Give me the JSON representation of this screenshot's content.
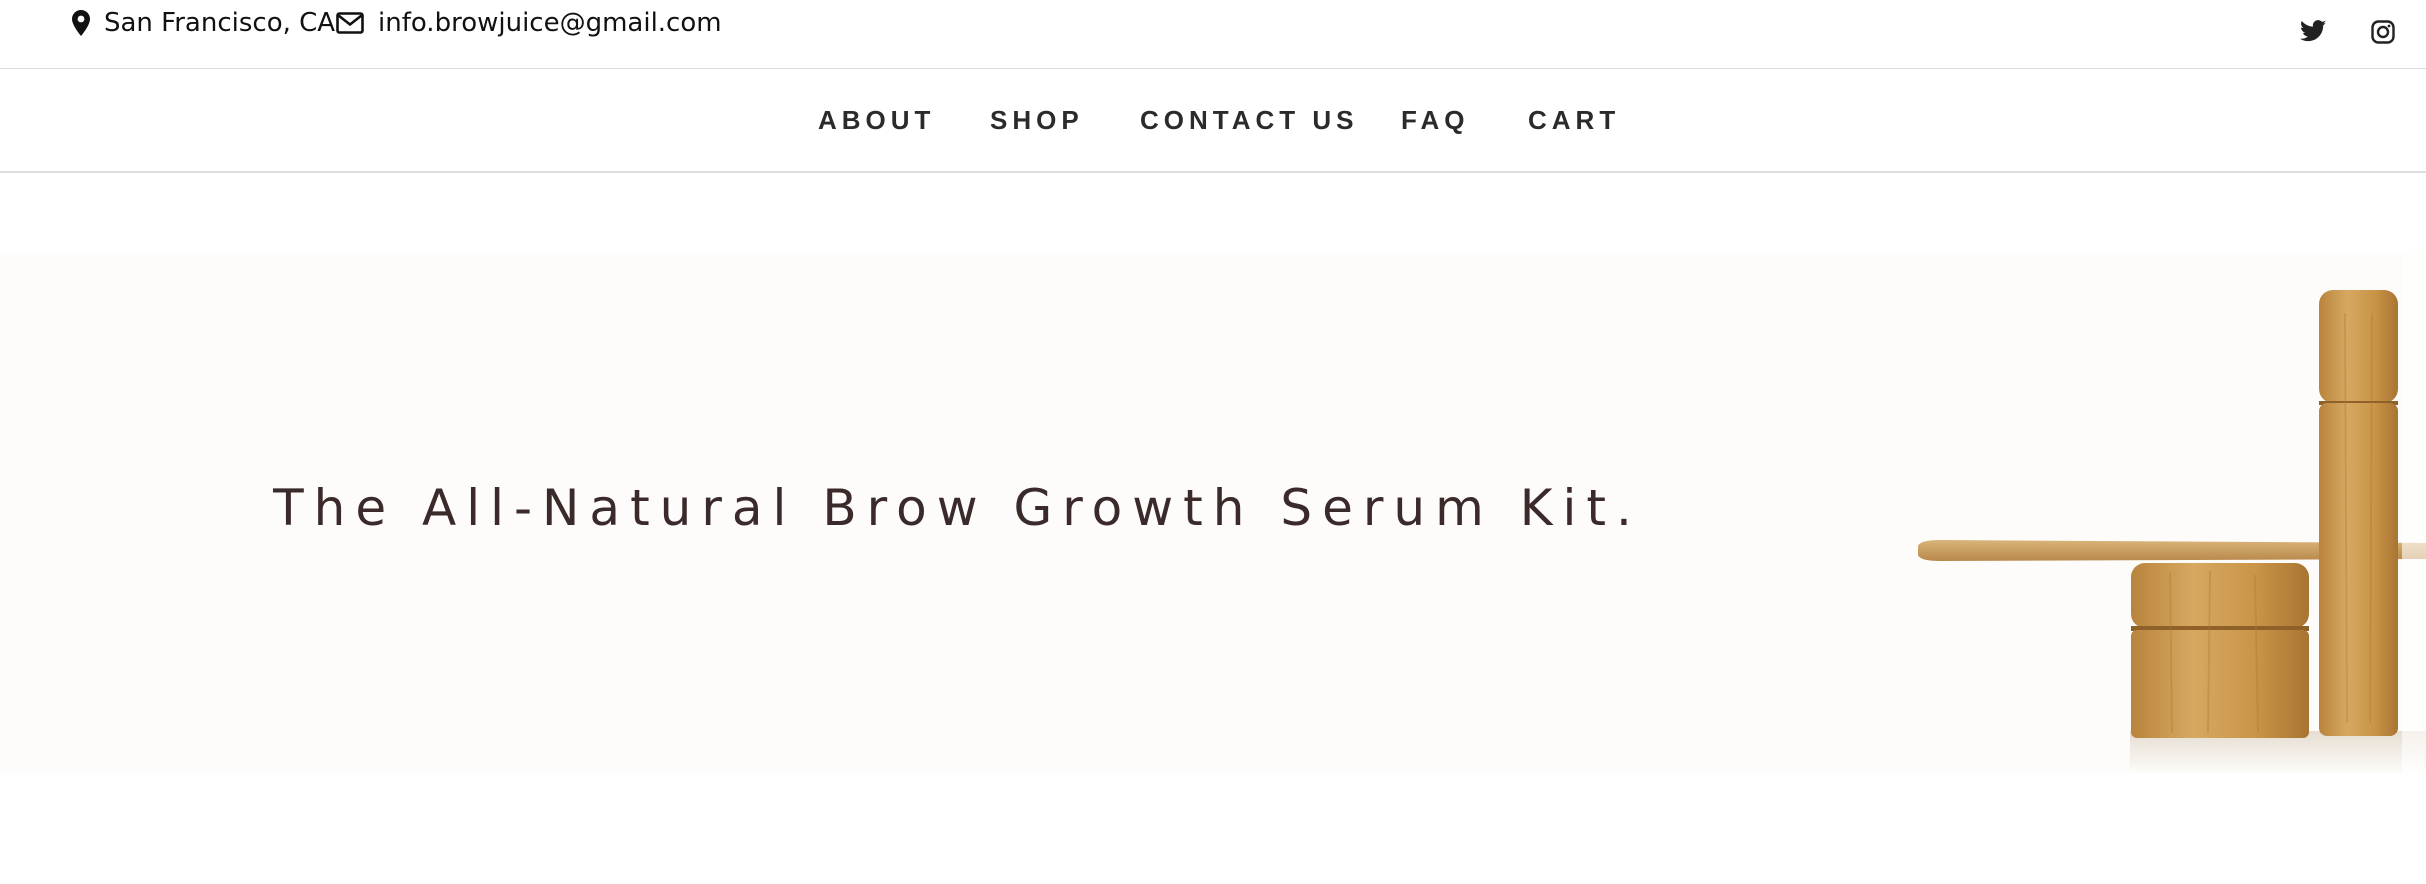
{
  "topbar": {
    "location": {
      "icon": "map-pin-icon",
      "text": "San Francisco, CA"
    },
    "email": {
      "icon": "envelope-icon",
      "text": "info.browjuice@gmail.com"
    },
    "social": [
      {
        "name": "twitter",
        "icon": "twitter-icon"
      },
      {
        "name": "instagram",
        "icon": "instagram-icon"
      }
    ]
  },
  "nav": {
    "items": [
      {
        "label": "ABOUT"
      },
      {
        "label": "SHOP"
      },
      {
        "label": "CONTACT US"
      },
      {
        "label": "FAQ"
      },
      {
        "label": "CART"
      }
    ]
  },
  "hero": {
    "headline": "The All-Natural Brow Growth Serum Kit.",
    "background_color": "#fdfcfa",
    "image_subject": "bamboo cosmetic jars, roller bottle and wooden spatula"
  },
  "colors": {
    "text": "#111111",
    "nav_text": "#2b2b2b",
    "headline": "#3a2a2a",
    "bamboo": "#c99a55"
  }
}
